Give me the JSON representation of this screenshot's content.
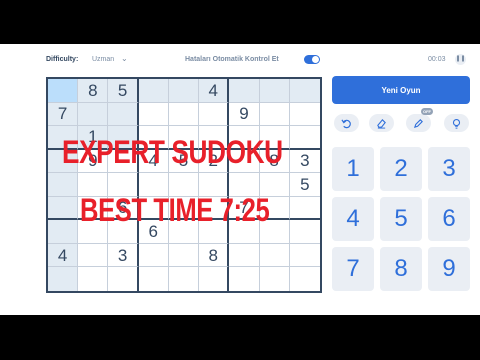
{
  "topbar": {
    "difficulty_label": "Difficulty:",
    "difficulty_value": "Uzman",
    "autocheck_label": "Hataları Otomatik Kontrol Et",
    "timer": "00:03"
  },
  "board": {
    "rows": [
      [
        "",
        "8",
        "5",
        "",
        "",
        "4",
        "",
        "",
        ""
      ],
      [
        "7",
        "",
        "",
        "",
        "",
        "",
        "9",
        "",
        ""
      ],
      [
        "",
        "1",
        "",
        "",
        "",
        "",
        "",
        "",
        ""
      ],
      [
        "",
        "9",
        "",
        "4",
        "5",
        "2",
        "",
        "8",
        "3"
      ],
      [
        "",
        "",
        "",
        "",
        "",
        "",
        "",
        "",
        "5"
      ],
      [
        "",
        "",
        "6",
        "",
        "",
        "",
        "7",
        "",
        ""
      ],
      [
        "",
        "",
        "",
        "6",
        "",
        "",
        "",
        "",
        ""
      ],
      [
        "4",
        "",
        "3",
        "",
        "",
        "8",
        "",
        "",
        ""
      ],
      [
        "",
        "",
        "",
        "",
        "",
        "",
        "",
        "",
        ""
      ]
    ],
    "selected": [
      0,
      0
    ]
  },
  "panel": {
    "new_game": "Yeni Oyun",
    "notes_badge": "OFF",
    "numbers": [
      "1",
      "2",
      "3",
      "4",
      "5",
      "6",
      "7",
      "8",
      "9"
    ]
  },
  "icons": {
    "undo": "undo-icon",
    "erase": "eraser-icon",
    "notes": "pencil-icon",
    "hint": "lightbulb-icon"
  },
  "colors": {
    "accent": "#2f6fda",
    "overlay_text": "#e8202a",
    "highlight": "#e2ebf3",
    "selected": "#bbdefb"
  },
  "overlay": {
    "line1": "EXPERT SUDOKU",
    "line2": "BEST TIME 7:25"
  }
}
